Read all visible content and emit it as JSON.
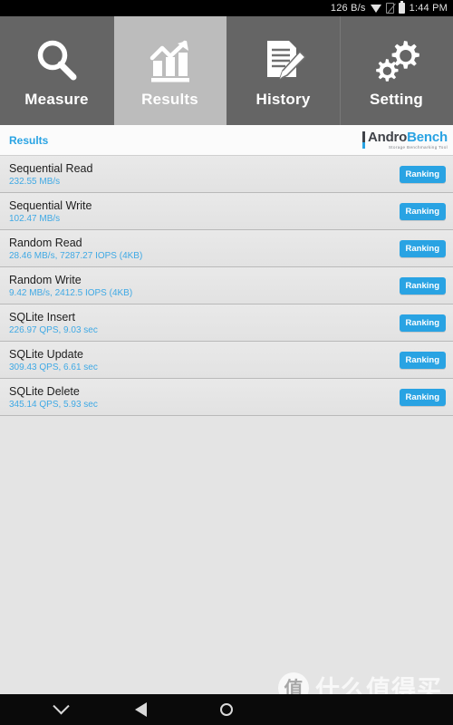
{
  "statusbar": {
    "network_speed": "126 B/s",
    "time": "1:44 PM",
    "icons": [
      "wifi-triangle-icon",
      "sim-disabled-icon",
      "battery-icon"
    ]
  },
  "tabs": [
    {
      "label": "Measure",
      "icon": "magnifier-icon",
      "active": false
    },
    {
      "label": "Results",
      "icon": "bar-chart-arrow-icon",
      "active": true
    },
    {
      "label": "History",
      "icon": "document-pencil-icon",
      "active": false
    },
    {
      "label": "Setting",
      "icon": "gears-icon",
      "active": false
    }
  ],
  "subheader": {
    "title": "Results",
    "logo": {
      "name_part1": "Andro",
      "name_part2": "Bench",
      "tagline": "Storage Benchmarking Tool"
    }
  },
  "results": {
    "button_label": "Ranking",
    "rows": [
      {
        "title": "Sequential Read",
        "value": "232.55 MB/s"
      },
      {
        "title": "Sequential Write",
        "value": "102.47 MB/s"
      },
      {
        "title": "Random Read",
        "value": "28.46 MB/s, 7287.27 IOPS (4KB)"
      },
      {
        "title": "Random Write",
        "value": "9.42 MB/s, 2412.5 IOPS (4KB)"
      },
      {
        "title": "SQLite Insert",
        "value": "226.97 QPS, 9.03 sec"
      },
      {
        "title": "SQLite Update",
        "value": "309.43 QPS, 6.61 sec"
      },
      {
        "title": "SQLite Delete",
        "value": "345.14 QPS, 5.93 sec"
      }
    ]
  },
  "watermark": {
    "logo_char": "值",
    "text": "什么值得买"
  },
  "navbar": {
    "buttons": [
      {
        "name": "chevron-down-icon"
      },
      {
        "name": "back-triangle-icon"
      },
      {
        "name": "home-circle-icon"
      }
    ]
  },
  "colors": {
    "accent_blue": "#29a3e3",
    "tab_inactive": "#656565",
    "tab_active": "#bcbcbc",
    "page_bg": "#e4e4e4"
  }
}
